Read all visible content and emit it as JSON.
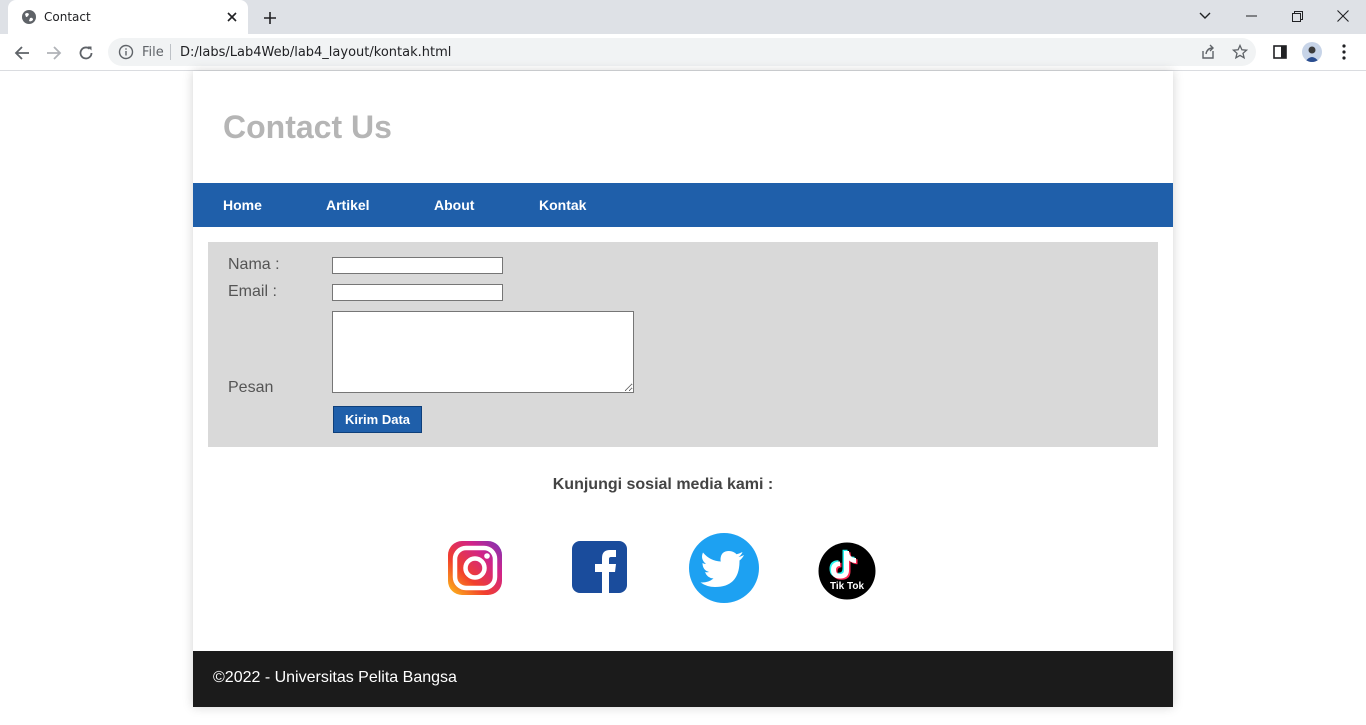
{
  "browser": {
    "tab_title": "Contact",
    "omnibox_scheme_label": "File",
    "url": "D:/labs/Lab4Web/lab4_layout/kontak.html"
  },
  "page": {
    "title": "Contact Us",
    "nav": [
      "Home",
      "Artikel",
      "About",
      "Kontak"
    ],
    "form": {
      "name_label": "Nama :",
      "name_value": "",
      "email_label": "Email :",
      "email_value": "",
      "message_label": "Pesan",
      "message_value": "",
      "submit_label": "Kirim Data"
    },
    "social_heading": "Kunjungi sosial media kami :",
    "social": [
      {
        "name": "instagram-icon",
        "tiktok_label": ""
      },
      {
        "name": "facebook-icon"
      },
      {
        "name": "twitter-icon"
      },
      {
        "name": "tiktok-icon",
        "label": "Tik Tok"
      }
    ],
    "footer": "©2022 - Universitas Pelita Bangsa"
  },
  "colors": {
    "nav_bg": "#1f5faa",
    "form_bg": "#d9d9d9",
    "footer_bg": "#1b1b1b",
    "title": "#b5b5b5"
  }
}
